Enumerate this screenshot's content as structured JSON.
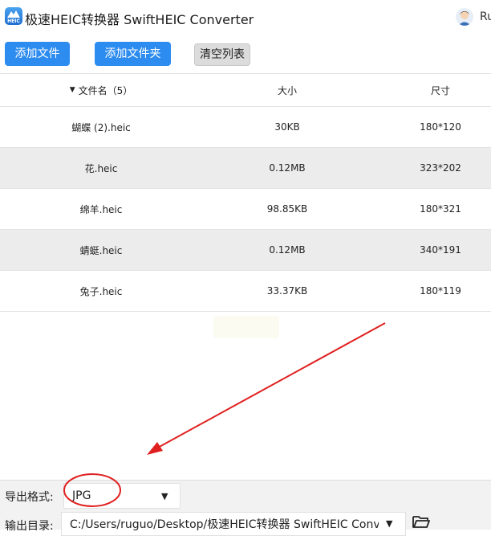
{
  "window": {
    "title": "极速HEIC转换器 SwiftHEIC Converter",
    "icon_text": "HEIC",
    "user": "Ru"
  },
  "toolbar": {
    "add_file": "添加文件",
    "add_folder": "添加文件夹",
    "clear_list": "清空列表"
  },
  "table": {
    "columns": [
      "文件名（5）",
      "大小",
      "尺寸"
    ],
    "rows": [
      {
        "name": "蝴蝶 (2).heic",
        "size": "30KB",
        "dim": "180*120"
      },
      {
        "name": "花.heic",
        "size": "0.12MB",
        "dim": "323*202"
      },
      {
        "name": "绵羊.heic",
        "size": "98.85KB",
        "dim": "180*321"
      },
      {
        "name": "蜻蜓.heic",
        "size": "0.12MB",
        "dim": "340*191"
      },
      {
        "name": "兔子.heic",
        "size": "33.37KB",
        "dim": "180*119"
      }
    ]
  },
  "export": {
    "format_label": "导出格式:",
    "format_value": "JPG",
    "output_label": "输出目录:",
    "output_path": "C:/Users/ruguo/Desktop/极速HEIC转换器 SwiftHEIC Converter"
  },
  "colors": {
    "accent": "#2d8cf0",
    "annotation": "#e02020",
    "alt_row": "#ececec"
  }
}
